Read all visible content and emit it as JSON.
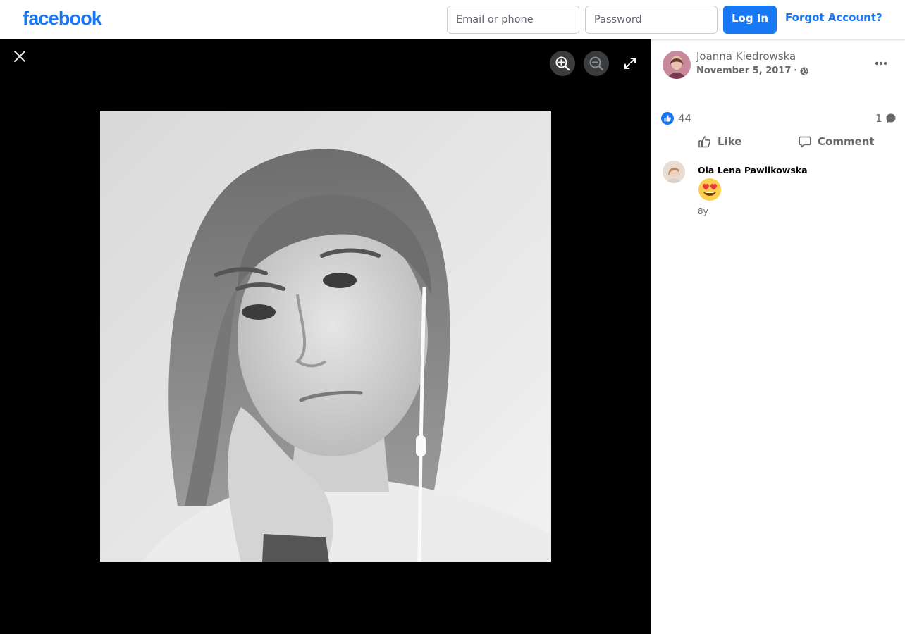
{
  "header": {
    "logo": "facebook",
    "email_placeholder": "Email or phone",
    "password_placeholder": "Password",
    "login_label": "Log In",
    "forgot_label": "Forgot Account?"
  },
  "viewer": {
    "photo_alt": "Photo"
  },
  "post": {
    "author": "Joanna Kiedrowska",
    "date": "November 5, 2017",
    "date_separator": "·",
    "privacy_icon": "globe-icon",
    "reaction_count": "44",
    "comment_count": "1",
    "like_label": "Like",
    "comment_label": "Comment"
  },
  "comments": [
    {
      "author": "Ola Lena Pawlikowska",
      "emoji": "heart-eyes-emoji",
      "time": "8y"
    }
  ],
  "colors": {
    "brand": "#1877f2",
    "secondary_text": "#65676b",
    "viewer_bg": "#000000"
  }
}
